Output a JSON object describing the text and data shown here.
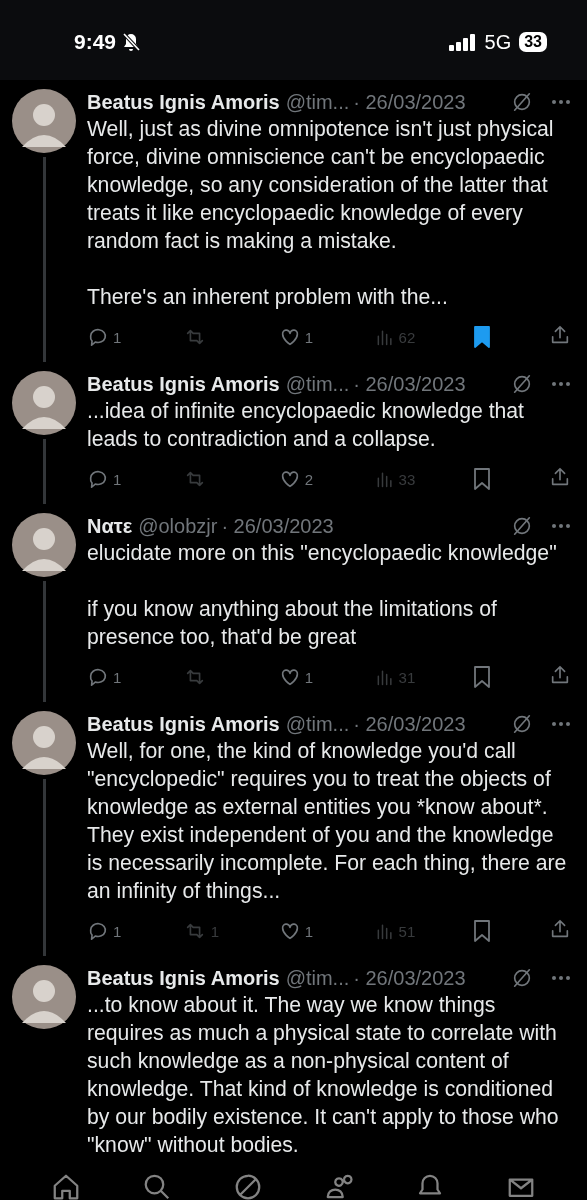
{
  "status_bar": {
    "time": "9:49",
    "network": "5G",
    "battery": "33"
  },
  "posts": [
    {
      "name": "Beatus Ignis Amoris",
      "handle": "@tim...",
      "date": "· 26/03/2023",
      "text": [
        "Well, just as divine omnipotence isn't just physical force, divine omniscience can't be encyclopaedic knowledge, so any consideration of the latter that treats it like encyclopaedic knowledge of every random fact is making a mistake.",
        "There's an inherent problem with the..."
      ],
      "replies": "1",
      "likes": "1",
      "views": "62",
      "bookmarked": true
    },
    {
      "name": "Beatus Ignis Amoris",
      "handle": "@tim...",
      "date": "· 26/03/2023",
      "text": [
        "...idea of infinite encyclopaedic knowledge that leads to contradiction and a collapse."
      ],
      "replies": "1",
      "likes": "2",
      "views": "33",
      "bookmarked": false
    },
    {
      "name": "Νατε",
      "handle": "@olobzjr",
      "date": "· 26/03/2023",
      "text": [
        "elucidate more on this \"encyclopaedic knowledge\"",
        "if you know anything about the limitations of presence too, that'd be great"
      ],
      "replies": "1",
      "likes": "1",
      "views": "31",
      "bookmarked": false
    },
    {
      "name": "Beatus Ignis Amoris",
      "handle": "@tim...",
      "date": "· 26/03/2023",
      "text": [
        "Well, for one, the kind of knowledge you'd call \"encyclopedic\" requires you to treat the objects of knowledge as external entities you *know about*. They exist independent of you and the knowledge is necessarily incomplete. For each thing, there are an infinity of things..."
      ],
      "replies": "1",
      "reposts": "1",
      "likes": "1",
      "views": "51",
      "bookmarked": false
    },
    {
      "name": "Beatus Ignis Amoris",
      "handle": "@tim...",
      "date": "· 26/03/2023",
      "text": [
        "...to know about it. The way we know things requires as much a physical state to correlate with such knowledge as a non-physical content of knowledge. That kind of knowledge is conditioned by our bodily existence. It can't apply to those who \"know\" without bodies."
      ]
    }
  ]
}
